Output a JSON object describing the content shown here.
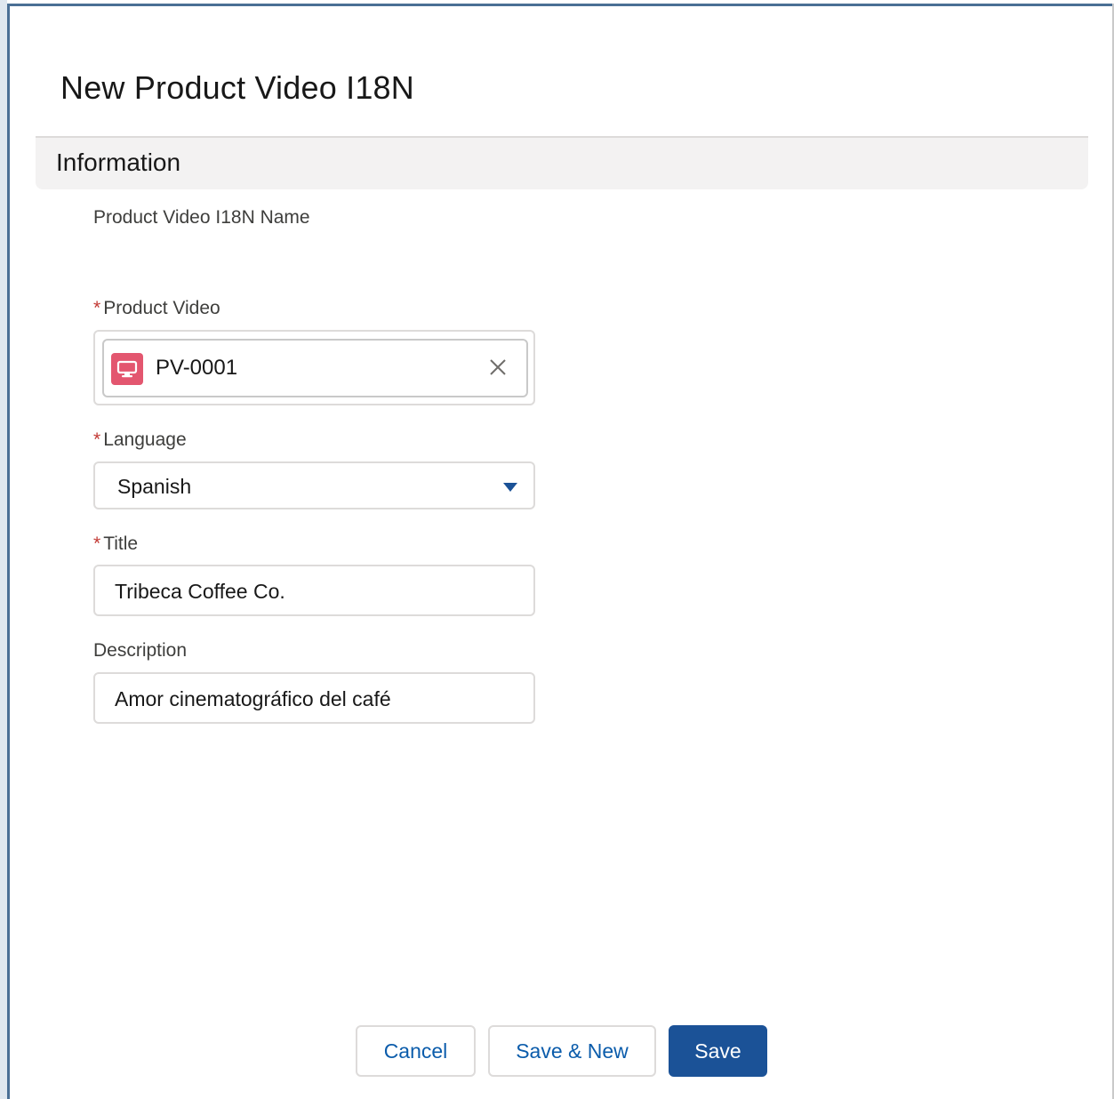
{
  "modal": {
    "title": "New Product Video I18N"
  },
  "section": {
    "title": "Information"
  },
  "fields": {
    "name": {
      "label": "Product Video I18N Name"
    },
    "product_video": {
      "required_marker": "*",
      "label": "Product Video",
      "value": "PV-0001",
      "icon": "monitor-icon",
      "icon_color": "#e3566f"
    },
    "language": {
      "required_marker": "*",
      "label": "Language",
      "value": "Spanish"
    },
    "title": {
      "required_marker": "*",
      "label": "Title",
      "value": "Tribeca Coffee Co."
    },
    "description": {
      "label": "Description",
      "value": "Amor cinematográfico del café"
    }
  },
  "footer": {
    "cancel_label": "Cancel",
    "save_new_label": "Save & New",
    "save_label": "Save"
  },
  "colors": {
    "brand": "#1b5297",
    "link": "#0b5cab",
    "required": "#c23934"
  }
}
